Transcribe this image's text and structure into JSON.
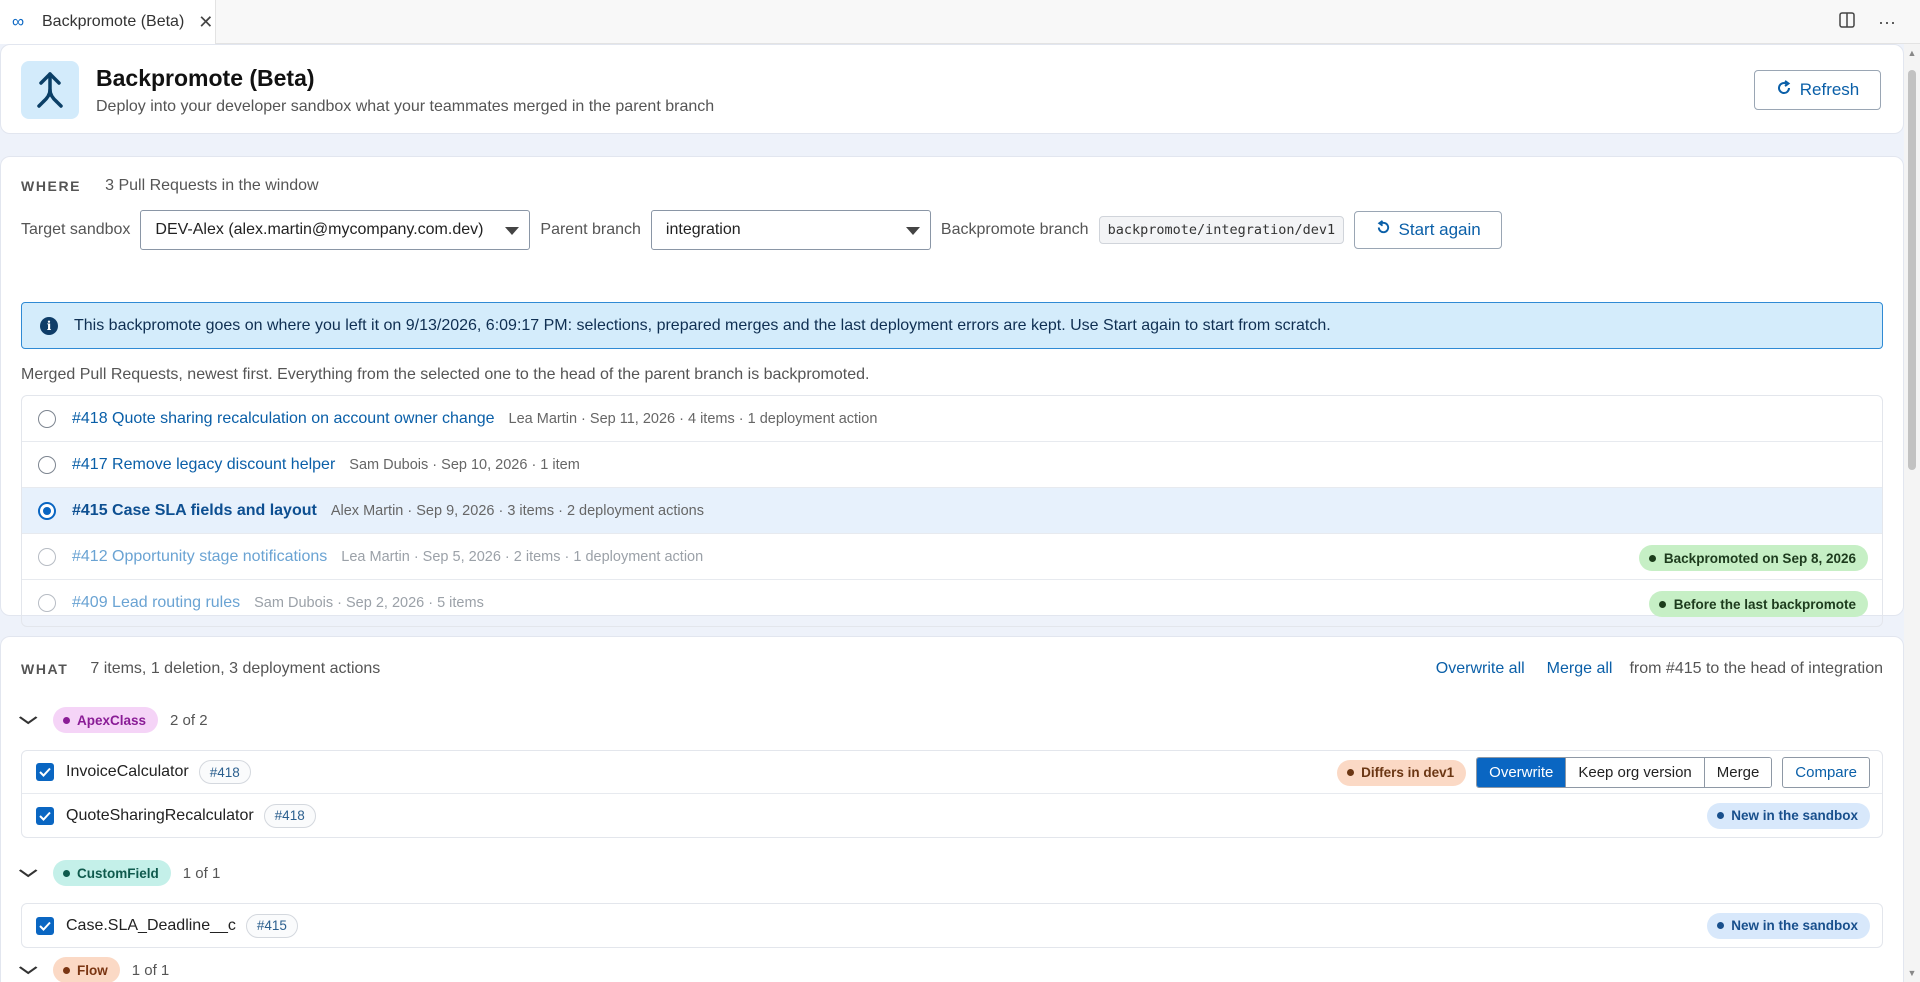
{
  "tab": {
    "title": "Backpromote (Beta)"
  },
  "header": {
    "title": "Backpromote (Beta)",
    "subtitle": "Deploy into your developer sandbox what your teammates merged in the parent branch",
    "refresh_label": "Refresh"
  },
  "where": {
    "label": "WHERE",
    "meta": "3 Pull Requests in the window",
    "target_sandbox_label": "Target sandbox",
    "target_sandbox_value": "DEV-Alex (alex.martin@mycompany.com.dev)",
    "parent_branch_label": "Parent branch",
    "parent_branch_value": "integration",
    "backpromote_branch_label": "Backpromote branch",
    "backpromote_branch_value": "backpromote/integration/dev1",
    "start_again_label": "Start again",
    "info_text": "This backpromote goes on where you left it on 9/13/2026, 6:09:17 PM: selections, prepared merges and the last deployment errors are kept. Use Start again to start from scratch.",
    "hint": "Merged Pull Requests, newest first. Everything from the selected one to the head of the parent branch is backpromoted.",
    "prs": [
      {
        "title": "#418 Quote sharing recalculation on account owner change",
        "meta": "Lea Martin · Sep 11, 2026 · 4 items · 1 deployment action",
        "status": ""
      },
      {
        "title": "#417 Remove legacy discount helper",
        "meta": "Sam Dubois · Sep 10, 2026 · 1 item",
        "status": ""
      },
      {
        "title": "#415 Case SLA fields and layout",
        "meta": "Alex Martin · Sep 9, 2026 · 3 items · 2 deployment actions",
        "status": ""
      },
      {
        "title": "#412 Opportunity stage notifications",
        "meta": "Lea Martin · Sep 5, 2026 · 2 items · 1 deployment action",
        "status": "Backpromoted on Sep 8, 2026"
      },
      {
        "title": "#409 Lead routing rules",
        "meta": "Sam Dubois · Sep 2, 2026 · 5 items",
        "status": "Before the last backpromote"
      }
    ]
  },
  "what": {
    "label": "WHAT",
    "meta": "7 items, 1 deletion, 3 deployment actions",
    "overwrite_all": "Overwrite all",
    "merge_all": "Merge all",
    "range_text": "from #415 to the head of integration",
    "groups": [
      {
        "type": "ApexClass",
        "count": "2 of 2",
        "items": [
          {
            "name": "InvoiceCalculator",
            "pr": "#418",
            "status": "Differs in dev1",
            "options": [
              "Overwrite",
              "Keep org version",
              "Merge"
            ],
            "compare": "Compare"
          },
          {
            "name": "QuoteSharingRecalculator",
            "pr": "#418",
            "status": "New in the sandbox"
          }
        ]
      },
      {
        "type": "CustomField",
        "count": "1 of 1",
        "items": [
          {
            "name": "Case.SLA_Deadline__c",
            "pr": "#415",
            "status": "New in the sandbox"
          }
        ]
      },
      {
        "type": "Flow",
        "count": "1 of 1",
        "items": []
      }
    ]
  },
  "icons": {
    "tab": "infinity-icon",
    "close": "close-icon",
    "split": "split-editor-icon",
    "more": "more-icon",
    "logo": "merge-arrow-icon",
    "refresh": "refresh-icon",
    "info": "info-icon",
    "chevron": "chevron-down-icon",
    "check": "check-icon"
  },
  "colors": {
    "accent": "#0a66c2",
    "info_bg": "#d4ecfb",
    "success_bg": "#c6efc5"
  }
}
